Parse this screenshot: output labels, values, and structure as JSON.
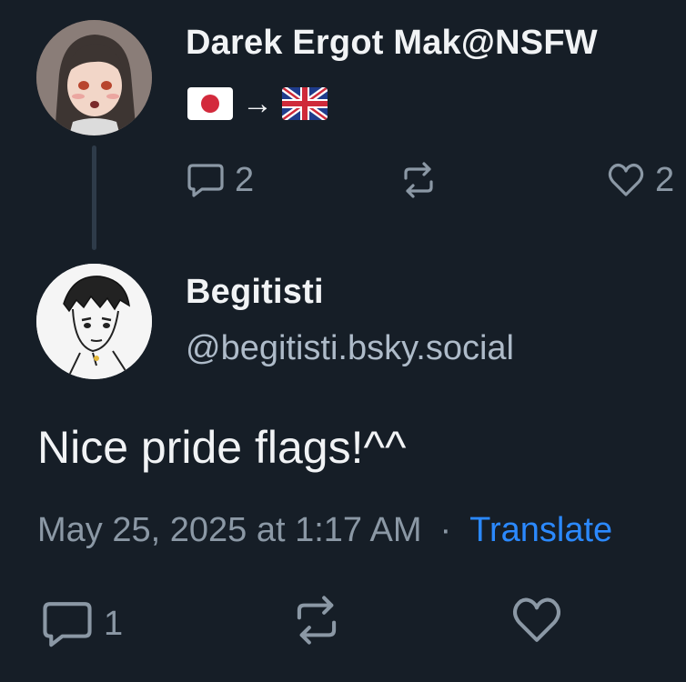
{
  "parent_post": {
    "author_name": "Darek Ergot Mak@NSFW",
    "bio_arrow": "→",
    "flags": [
      "japan-flag",
      "uk-flag"
    ],
    "replies_count": "2",
    "likes_count": "2"
  },
  "reply_post": {
    "author_name": "Begitisti",
    "handle": "@begitisti.bsky.social",
    "text": "Nice pride flags!^^",
    "timestamp": "May 25, 2025 at 1:17 AM",
    "separator": "·",
    "translate_label": "Translate",
    "replies_count": "1"
  },
  "colors": {
    "background": "#161e27",
    "text": "#f1f3f5",
    "muted": "#8b98a5",
    "accent": "#2b89ff"
  }
}
